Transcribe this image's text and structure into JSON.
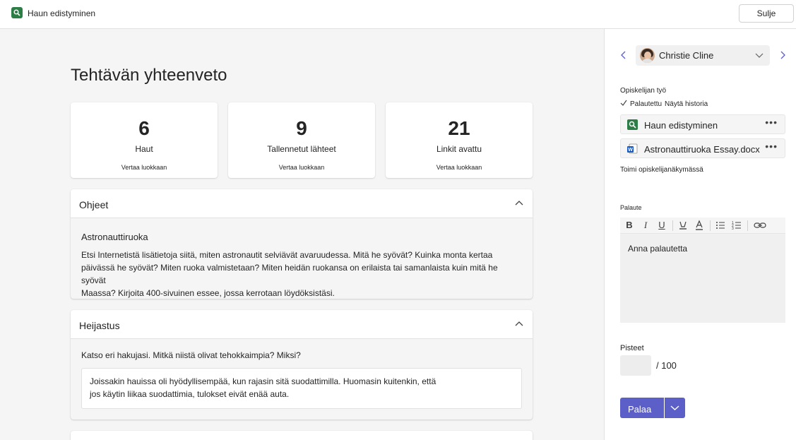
{
  "window": {
    "title": "Haun edistyminen",
    "close_label": "Sulje"
  },
  "summary": {
    "title": "Tehtävän yhteenveto",
    "stats": [
      {
        "value": "6",
        "label": "Haut",
        "link": "Vertaa luokkaan"
      },
      {
        "value": "9",
        "label": "Tallennetut lähteet",
        "link": "Vertaa luokkaan"
      },
      {
        "value": "21",
        "label": "Linkit avattu",
        "link": "Vertaa luokkaan"
      }
    ]
  },
  "instructions": {
    "title": "Ohjeet",
    "heading": "Astronauttiruoka",
    "lines": [
      "Etsi Internetistä lisätietoja siitä, miten astronautit selviävät avaruudessa. Mitä he syövät? Kuinka monta kertaa",
      "päivässä he syövät? Miten ruoka valmistetaan? Miten heidän ruokansa on erilaista tai samanlaista kuin mitä he syövät",
      "Maassa? Kirjoita 400-sivuinen essee, jossa kerrotaan löydöksistäsi."
    ]
  },
  "reflection": {
    "title": "Heijastus",
    "question": "Katso eri hakujasi. Mitkä niistä olivat tehokkaimpia? Miksi?",
    "answer_lines": [
      "Joissakin hauissa oli hyödyllisempää, kun rajasin sitä suodattimilla. Huomasin kuitenkin, että",
      "jos käytin liikaa suodattimia, tulokset eivät enää auta."
    ]
  },
  "side": {
    "student_name": "Christie Cline",
    "student_work_label": "Opiskelijan työ",
    "status": "Palautettu",
    "history_link": "Näytä historia",
    "files": [
      {
        "name": "Haun edistyminen",
        "icon": "search-progress-icon"
      },
      {
        "name": "Astronauttiruoka Essay.docx",
        "icon": "word-icon"
      }
    ],
    "act_as_student": "Toimi opiskelijanäkymässä",
    "feedback_label": "Palaute",
    "feedback_placeholder": "Anna palautetta",
    "points_label": "Pisteet",
    "points_value": "",
    "points_max": "/ 100",
    "return_label": "Palaa"
  },
  "colors": {
    "accent": "#5b5fc7",
    "app_icon": "#2d7d46",
    "word_icon": "#185abd"
  }
}
